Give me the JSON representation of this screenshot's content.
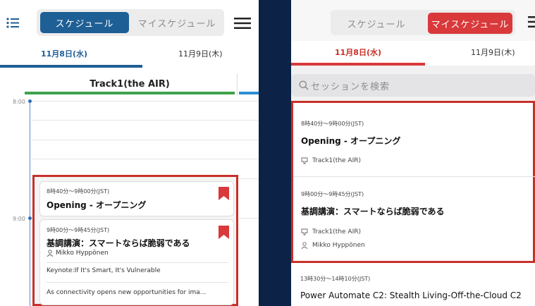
{
  "left": {
    "segment": {
      "tab1": "スケジュール",
      "tab2": "マイスケジュール"
    },
    "dates": {
      "d1": "11月8日(水)",
      "d2": "11月9日(木)"
    },
    "track": "Track1(the AIR)",
    "times": {
      "t1": "8:00",
      "t2": "9:00"
    },
    "cards": [
      {
        "time": "8時40分～9時00分(JST)",
        "title": "Opening - オープニング"
      },
      {
        "time": "9時00分～9時45分(JST)",
        "title": "基調講演：スマートならば脆弱である",
        "speaker": "Mikko Hyppönen",
        "keynote": "Keynote:If It's Smart, It's Vulnerable",
        "desc": "As connectivity opens new opportunities for ima..."
      }
    ]
  },
  "right": {
    "segment": {
      "tab1": "スケジュール",
      "tab2": "マイスケジュール"
    },
    "dates": {
      "d1": "11月8日(水)",
      "d2": "11月9日(木)"
    },
    "search_placeholder": "セッションを検索",
    "items": [
      {
        "time": "8時40分～9時00分(JST)",
        "title": "Opening - オープニング",
        "track": "Track1(the AIR)"
      },
      {
        "time": "9時00分～9時45分(JST)",
        "title": "基調講演：スマートならば脆弱である",
        "track": "Track1(the AIR)",
        "speaker": "Mikko Hyppönen"
      }
    ],
    "tail": {
      "time": "13時30分～14時10分(JST)",
      "title": "Power Automate C2: Stealth Living-Off-the-Cloud C2"
    }
  },
  "colors": {
    "primary_blue": "#1e5f95",
    "accent_red": "#d9393b",
    "highlight_border": "#c8302a",
    "background": "#0c2246"
  }
}
